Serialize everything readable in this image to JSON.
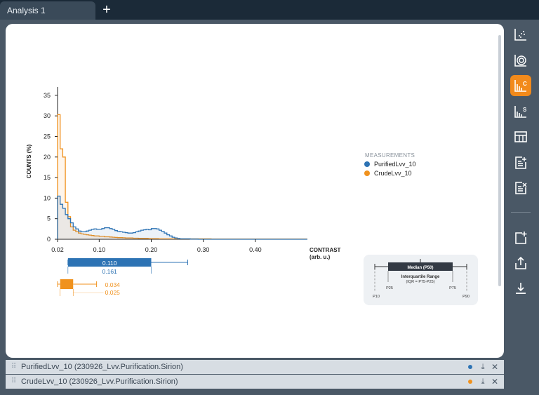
{
  "tab": {
    "label": "Analysis 1",
    "add_label": "+"
  },
  "colors": {
    "purified": "#2d73b4",
    "crude": "#f0921e",
    "accent": "#f28a1b",
    "panel": "#ffffff",
    "rail": "#4a5866"
  },
  "rail_icons": [
    "scatter-plot-icon",
    "target-icon",
    "histogram-c-icon",
    "histogram-s-icon",
    "table-icon",
    "add-note-icon",
    "edit-note-icon",
    "add-panel-icon",
    "share-icon",
    "download-icon"
  ],
  "rail_active_icon": "histogram-c-icon",
  "samples": [
    {
      "name": "PurifiedLvv_10 (230926_Lvv.Purification.Sirion)",
      "color": "#2d73b4"
    },
    {
      "name": "CrudeLvv_10 (230926_Lvv.Purification.Sirion)",
      "color": "#f0921e"
    }
  ],
  "chart_data": {
    "type": "histogram",
    "ylabel": "COUNTS (%)",
    "xlabel_line1": "CONTRAST",
    "xlabel_line2": "(arb. u.)",
    "xlim": [
      0.02,
      0.5
    ],
    "ylim": [
      0,
      36
    ],
    "x_ticks": [
      "0.02",
      "0.10",
      "0.20",
      "0.30",
      "0.40"
    ],
    "x_tick_values": [
      0.02,
      0.1,
      0.2,
      0.3,
      0.4
    ],
    "y_ticks": [
      0,
      5,
      10,
      15,
      20,
      25,
      30,
      35
    ],
    "bin_width": 0.005,
    "legend": {
      "title": "MEASUREMENTS",
      "placement": "right"
    },
    "series": [
      {
        "name": "PurifiedLvv_10",
        "color": "#2d73b4",
        "values": [
          10.5,
          8.5,
          7.5,
          6.0,
          5.0,
          4.0,
          3.0,
          2.5,
          2.0,
          1.8,
          1.8,
          2.0,
          2.2,
          2.4,
          2.5,
          2.4,
          2.4,
          2.6,
          2.8,
          2.8,
          2.6,
          2.4,
          2.1,
          1.9,
          1.8,
          1.7,
          1.6,
          1.5,
          1.5,
          1.6,
          1.8,
          2.0,
          2.2,
          2.3,
          2.4,
          2.3,
          2.6,
          2.6,
          2.5,
          2.2,
          1.9,
          1.5,
          1.1,
          0.8,
          0.5,
          0.3,
          0.2,
          0.1,
          0.1,
          0.1,
          0.1,
          0.05,
          0.05,
          0.05,
          0,
          0,
          0,
          0,
          0,
          0,
          0,
          0,
          0,
          0,
          0,
          0,
          0,
          0,
          0,
          0,
          0,
          0,
          0,
          0,
          0,
          0,
          0,
          0,
          0,
          0,
          0,
          0,
          0,
          0,
          0,
          0,
          0,
          0,
          0,
          0,
          0,
          0,
          0,
          0,
          0,
          0
        ]
      },
      {
        "name": "CrudeLvv_10",
        "color": "#f0921e",
        "values": [
          30.3,
          22.0,
          20.0,
          9.0,
          5.5,
          3.0,
          2.2,
          1.8,
          1.5,
          1.3,
          1.2,
          1.1,
          1.0,
          0.9,
          0.8,
          0.8,
          0.7,
          0.7,
          0.6,
          0.6,
          0.55,
          0.5,
          0.45,
          0.4,
          0.4,
          0.35,
          0.3,
          0.3,
          0.3,
          0.25,
          0.25,
          0.2,
          0.2,
          0.2,
          0.2,
          0.15,
          0.15,
          0.15,
          0.15,
          0.1,
          0.1,
          0.1,
          0.1,
          0.1,
          0.1,
          0.1,
          0.1,
          0.1,
          0.1,
          0.1,
          0.1,
          0.1,
          0.1,
          0.1,
          0.1,
          0.1,
          0.1,
          0.1,
          0.1,
          0.05,
          0.05,
          0.05,
          0.05,
          0.05,
          0.05,
          0.05,
          0.05,
          0.05,
          0.05,
          0.05,
          0.05,
          0.05,
          0.05,
          0.05,
          0.05,
          0.05,
          0.05,
          0.05,
          0.05,
          0.05,
          0.05,
          0.05,
          0.05,
          0.05,
          0.05,
          0.05,
          0.05,
          0.05,
          0.05,
          0.05,
          0.05,
          0.05,
          0.05,
          0.05,
          0.05,
          0.05
        ]
      }
    ],
    "boxplots": [
      {
        "series": "PurifiedLvv_10",
        "p10": 0.04,
        "p25": 0.04,
        "median_label": "0.110",
        "p75": 0.2,
        "p90": 0.27,
        "iqr_label": "0.161"
      },
      {
        "series": "CrudeLvv_10",
        "p10": 0.02,
        "p25": 0.025,
        "median_label": "0.034",
        "p75": 0.05,
        "p90": 0.095,
        "iqr_label": "0.025"
      }
    ],
    "key": {
      "median": "Median (P50)",
      "iqr": "Interquartile Range",
      "iqr_formula": "(IQR = P75-P25)",
      "p10": "P10",
      "p25": "P25",
      "p75": "P75",
      "p90": "P90"
    }
  }
}
